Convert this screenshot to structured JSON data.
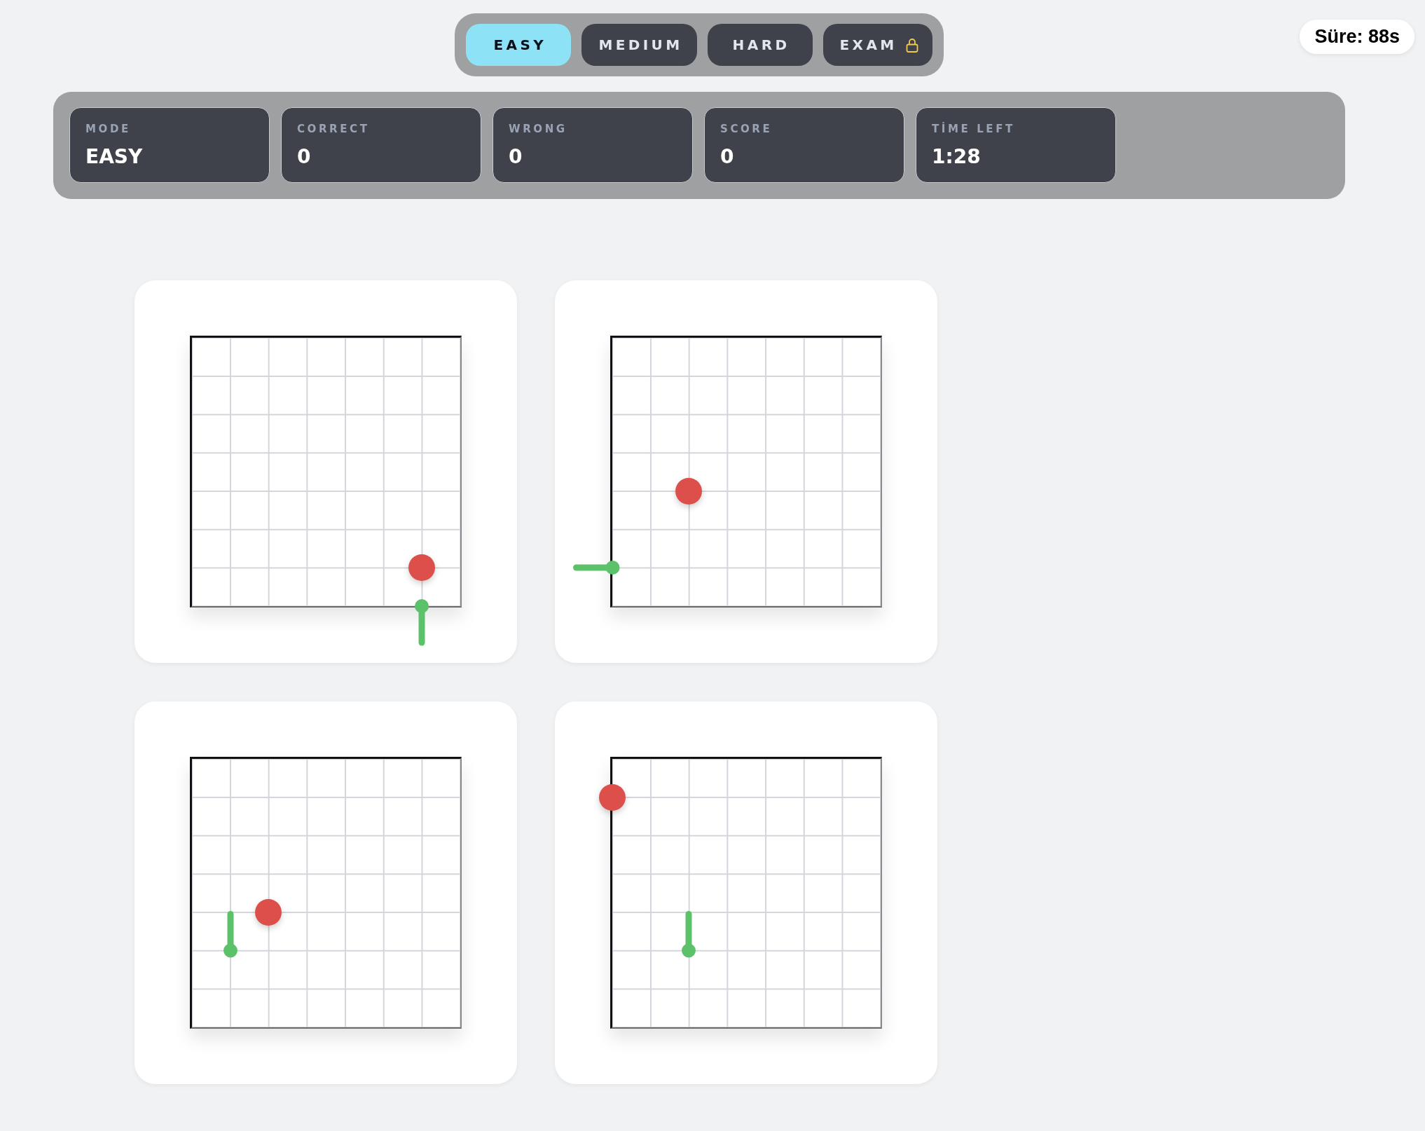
{
  "tabs": [
    {
      "label": "EASY",
      "selected": true,
      "locked": false
    },
    {
      "label": "MEDIUM",
      "selected": false,
      "locked": false
    },
    {
      "label": "HARD",
      "selected": false,
      "locked": false
    },
    {
      "label": "EXAM",
      "selected": false,
      "locked": true
    }
  ],
  "timer": "Süre: 88s",
  "stats": [
    {
      "label": "MODE",
      "value": "EASY"
    },
    {
      "label": "CORRECT",
      "value": "0"
    },
    {
      "label": "WRONG",
      "value": "0"
    },
    {
      "label": "SCORE",
      "value": "0"
    },
    {
      "label": "TİME LEFT",
      "value": "1:28"
    }
  ],
  "boards": [
    {
      "kind": "down"
    },
    {
      "kind": "left"
    },
    {
      "kind": "up"
    },
    {
      "kind": "up"
    }
  ]
}
